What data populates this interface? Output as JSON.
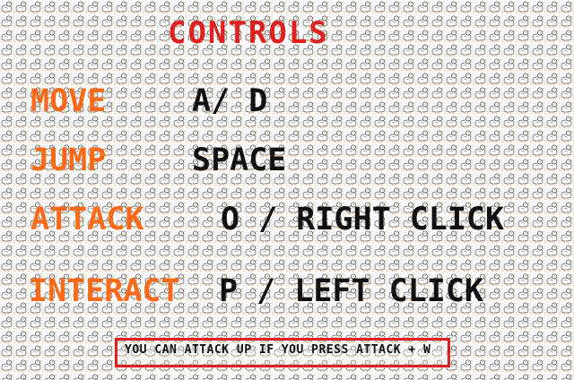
{
  "screen": {
    "title": "CONTROLS",
    "title_color": "#e0201e",
    "label_color": "#ff6a1a",
    "value_color": "#111111",
    "background": "tiled-duck-pattern"
  },
  "controls": [
    {
      "label": "MOVE",
      "keys": "A/ D"
    },
    {
      "label": "JUMP",
      "keys": "SPACE"
    },
    {
      "label": "ATTACK",
      "keys": "O / RIGHT CLICK"
    },
    {
      "label": "INTERACT",
      "keys": "P / LEFT CLICK"
    }
  ],
  "tip": {
    "text": "YOU CAN ATTACK UP IF YOU PRESS ATTACK + W",
    "border_color": "#e0201e"
  }
}
